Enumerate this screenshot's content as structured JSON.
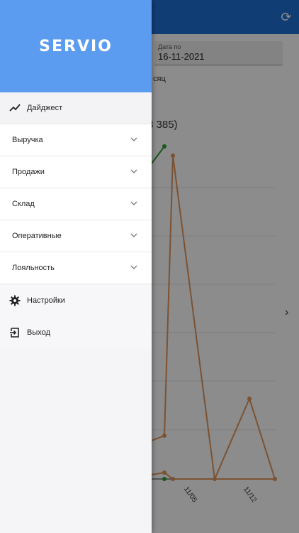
{
  "app": {
    "logo": "SERVIO"
  },
  "filters": {
    "date_to_label": "Дата по",
    "date_to_value": "16-11-2021",
    "period_partial": "сяц"
  },
  "summary": {
    "total_partial": "3 385)"
  },
  "chart": {
    "x_ticks": [
      "11/05",
      "11/12"
    ],
    "colors": {
      "orange": "#e0955b",
      "green": "#2e9e3a",
      "grid": "#e5e5e5"
    }
  },
  "drawer": {
    "digest": "Дайджест",
    "sections": [
      {
        "label": "Выручка"
      },
      {
        "label": "Продажи"
      },
      {
        "label": "Склад"
      },
      {
        "label": "Оперативные"
      },
      {
        "label": "Лояльность"
      }
    ],
    "settings": "Настройки",
    "logout": "Выход"
  },
  "colors": {
    "header_blue": "#5c9cf0",
    "topbar_blue": "#1f6fd6"
  }
}
